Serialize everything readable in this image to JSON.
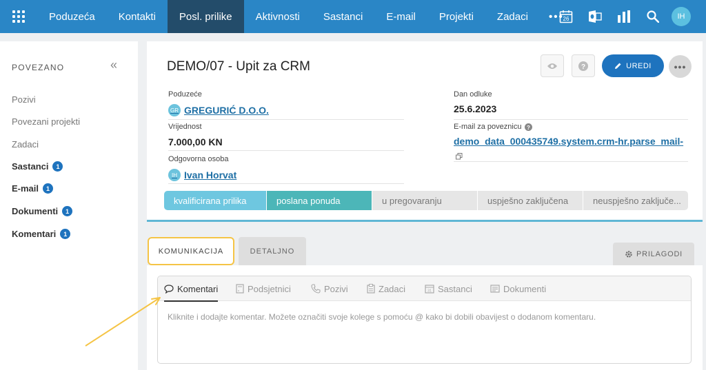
{
  "nav": {
    "items": [
      "Poduzeća",
      "Kontakti",
      "Posl. prilike",
      "Aktivnosti",
      "Sastanci",
      "E-mail",
      "Projekti",
      "Zadaci"
    ],
    "active": "Posl. prilike",
    "more": "•••",
    "icons": [
      "calendar-icon",
      "outlook-icon",
      "bar-chart-icon",
      "search-icon"
    ],
    "calendar_day": "26",
    "user_initials": "IH",
    "bg_color": "#2a86c6"
  },
  "sidebar": {
    "heading": "POVEZANO",
    "collapse": "«",
    "items": [
      {
        "label": "Pozivi",
        "badge": ""
      },
      {
        "label": "Povezani projekti",
        "badge": ""
      },
      {
        "label": "Zadaci",
        "badge": ""
      },
      {
        "label": "Sastanci",
        "badge": "1"
      },
      {
        "label": "E-mail",
        "badge": "1"
      },
      {
        "label": "Dokumenti",
        "badge": "1"
      },
      {
        "label": "Komentari",
        "badge": "1"
      }
    ]
  },
  "deal": {
    "title": "DEMO/07 - Upit za CRM",
    "edit_label": "UREDI",
    "more_label": "•••",
    "company_label": "Poduzeće",
    "company_initials": "GR",
    "company": "GREGURIĆ D.O.O.",
    "value_label": "Vrijednost",
    "value": "7.000,00 KN",
    "owner_label": "Odgovorna osoba",
    "owner_initials": "IH",
    "owner": "Ivan Horvat",
    "decision_label": "Dan odluke",
    "decision_date": "25.6.2023",
    "email_label": "E-mail za poveznicu",
    "email": "demo_data_000435749.system.crm-hr.parse_mail-",
    "stages": [
      "kvalificirana prilika",
      "poslana ponuda",
      "u pregovaranju",
      "uspješno zaključena",
      "neuspješno zaključe..."
    ],
    "accent_color": "#1e73be"
  },
  "tabs": {
    "communication": "KOMUNIKACIJA",
    "details": "DETALJNO",
    "customize": "PRILAGODI"
  },
  "comm": {
    "tabs": [
      "Komentari",
      "Podsjetnici",
      "Pozivi",
      "Zadaci",
      "Sastanci",
      "Dokumenti"
    ],
    "active": "Komentari",
    "placeholder": "Kliknite i dodajte komentar. Možete označiti svoje kolege s pomoću @ kako bi dobili obavijest o dodanom komentaru."
  }
}
